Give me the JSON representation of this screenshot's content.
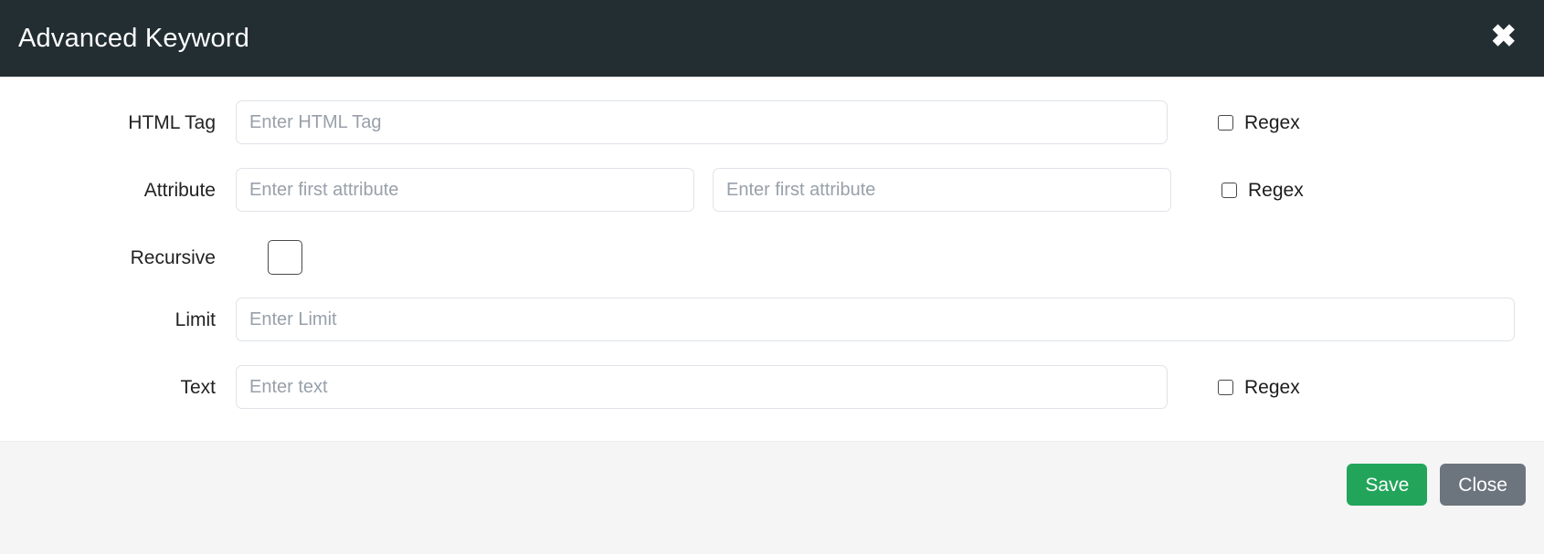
{
  "modal": {
    "title": "Advanced Keyword",
    "close_icon": "close-x-icon"
  },
  "form": {
    "rows": [
      {
        "label": "HTML Tag",
        "placeholder": "Enter HTML Tag",
        "regex_label": "Regex",
        "regex_checked": false
      },
      {
        "label": "Attribute",
        "placeholder": "Enter first attribute",
        "placeholder2": "Enter first attribute",
        "regex_label": "Regex",
        "regex_checked": false
      },
      {
        "label": "Recursive",
        "checked": false
      },
      {
        "label": "Limit",
        "placeholder": "Enter Limit"
      },
      {
        "label": "Text",
        "placeholder": "Enter text",
        "regex_label": "Regex",
        "regex_checked": false
      }
    ]
  },
  "footer": {
    "save_label": "Save",
    "close_label": "Close"
  },
  "colors": {
    "header_bg": "#232e33",
    "footer_bg": "#f5f5f5",
    "save_green": "#22a55b",
    "close_gray": "#6c757d",
    "input_border": "#dfe3e8",
    "placeholder_text": "#98a0aa"
  }
}
